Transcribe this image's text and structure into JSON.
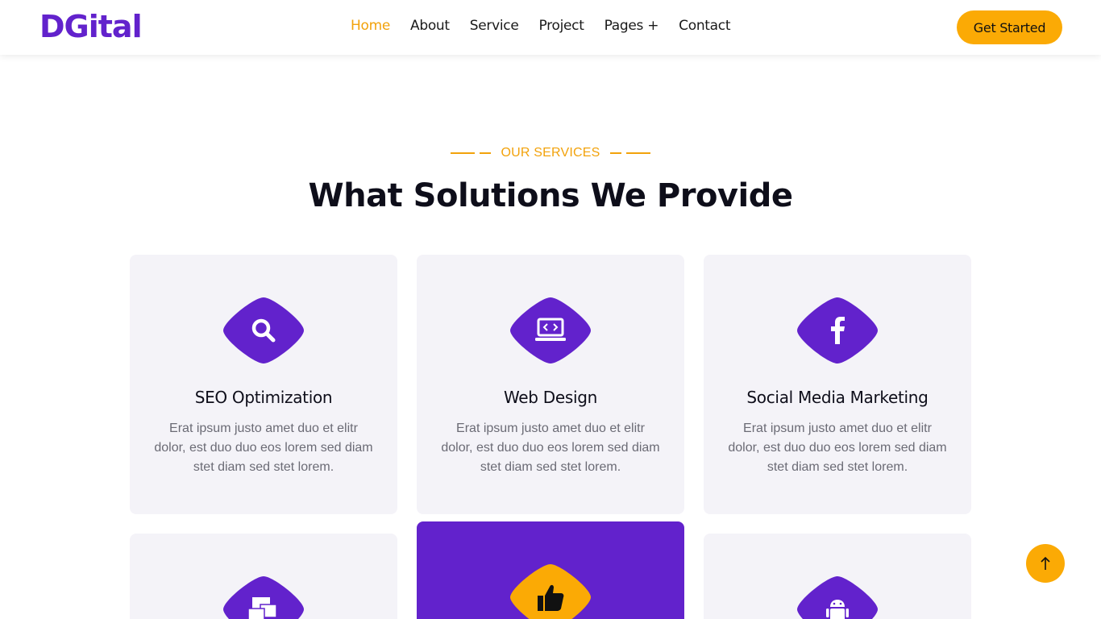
{
  "brand": "DGital",
  "nav": {
    "items": [
      {
        "label": "Home",
        "active": true
      },
      {
        "label": "About"
      },
      {
        "label": "Service"
      },
      {
        "label": "Project"
      },
      {
        "label": "Pages +"
      },
      {
        "label": "Contact"
      }
    ],
    "cta": "Get Started"
  },
  "section": {
    "eyebrow": "OUR SERVICES",
    "title": "What Solutions We Provide"
  },
  "cards": [
    {
      "title": "SEO Optimization",
      "icon": "search-icon",
      "text": "Erat ipsum justo amet duo et elitr dolor, est duo duo eos lorem sed diam stet diam sed stet lorem."
    },
    {
      "title": "Web Design",
      "icon": "laptop-code-icon",
      "text": "Erat ipsum justo amet duo et elitr dolor, est duo duo eos lorem sed diam stet diam sed stet lorem."
    },
    {
      "title": "Social Media Marketing",
      "icon": "facebook-icon",
      "text": "Erat ipsum justo amet duo et elitr dolor, est duo duo eos lorem sed diam stet diam sed stet lorem."
    },
    {
      "title": "",
      "icon": "mail-bulk-icon",
      "text": ""
    },
    {
      "title": "",
      "icon": "thumbs-up-icon",
      "text": "",
      "highlight": true
    },
    {
      "title": "",
      "icon": "android-icon",
      "text": ""
    }
  ],
  "colors": {
    "brand": "#6222cc",
    "accent": "#fbaa05",
    "card_bg": "#f4f3f8"
  }
}
